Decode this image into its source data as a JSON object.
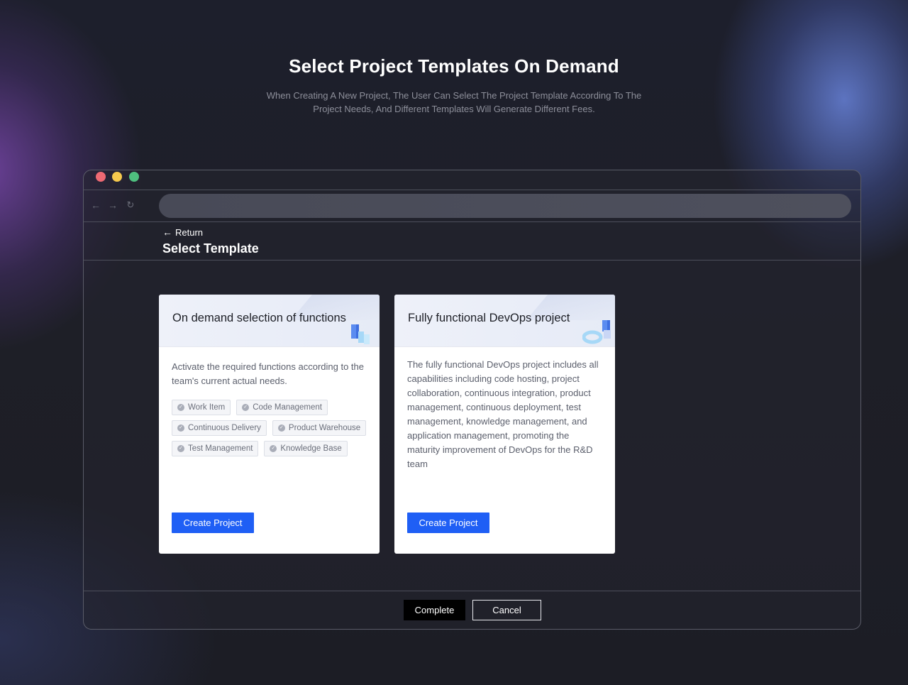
{
  "hero": {
    "title": "Select Project Templates On Demand",
    "subtitle": "When Creating A New Project, The User Can Select The Project Template According To The Project Needs, And Different Templates Will Generate Different Fees."
  },
  "browser": {
    "nav_icons": [
      "back-arrow-icon",
      "forward-arrow-icon",
      "reload-icon"
    ]
  },
  "page": {
    "return_label": "Return",
    "title": "Select Template"
  },
  "cards": [
    {
      "title": "On demand selection of functions",
      "description": "Activate the required functions according to the team's current actual needs.",
      "tags": [
        "Work Item",
        "Code Management",
        "Continuous Delivery",
        "Product Warehouse",
        "Test Management",
        "Knowledge Base"
      ],
      "button": "Create Project"
    },
    {
      "title": "Fully functional DevOps project",
      "description": "The fully functional DevOps project includes all capabilities including code hosting, project collaboration, continuous integration, product management, continuous deployment, test management, knowledge management, and application management, promoting the maturity improvement of DevOps for the R&D team",
      "button": "Create Project"
    }
  ],
  "footer": {
    "complete_label": "Complete",
    "cancel_label": "Cancel"
  },
  "colors": {
    "primary": "#1f5ff5",
    "dot_red": "#ee6a73",
    "dot_yellow": "#f6c94d",
    "dot_green": "#4fc07f"
  }
}
